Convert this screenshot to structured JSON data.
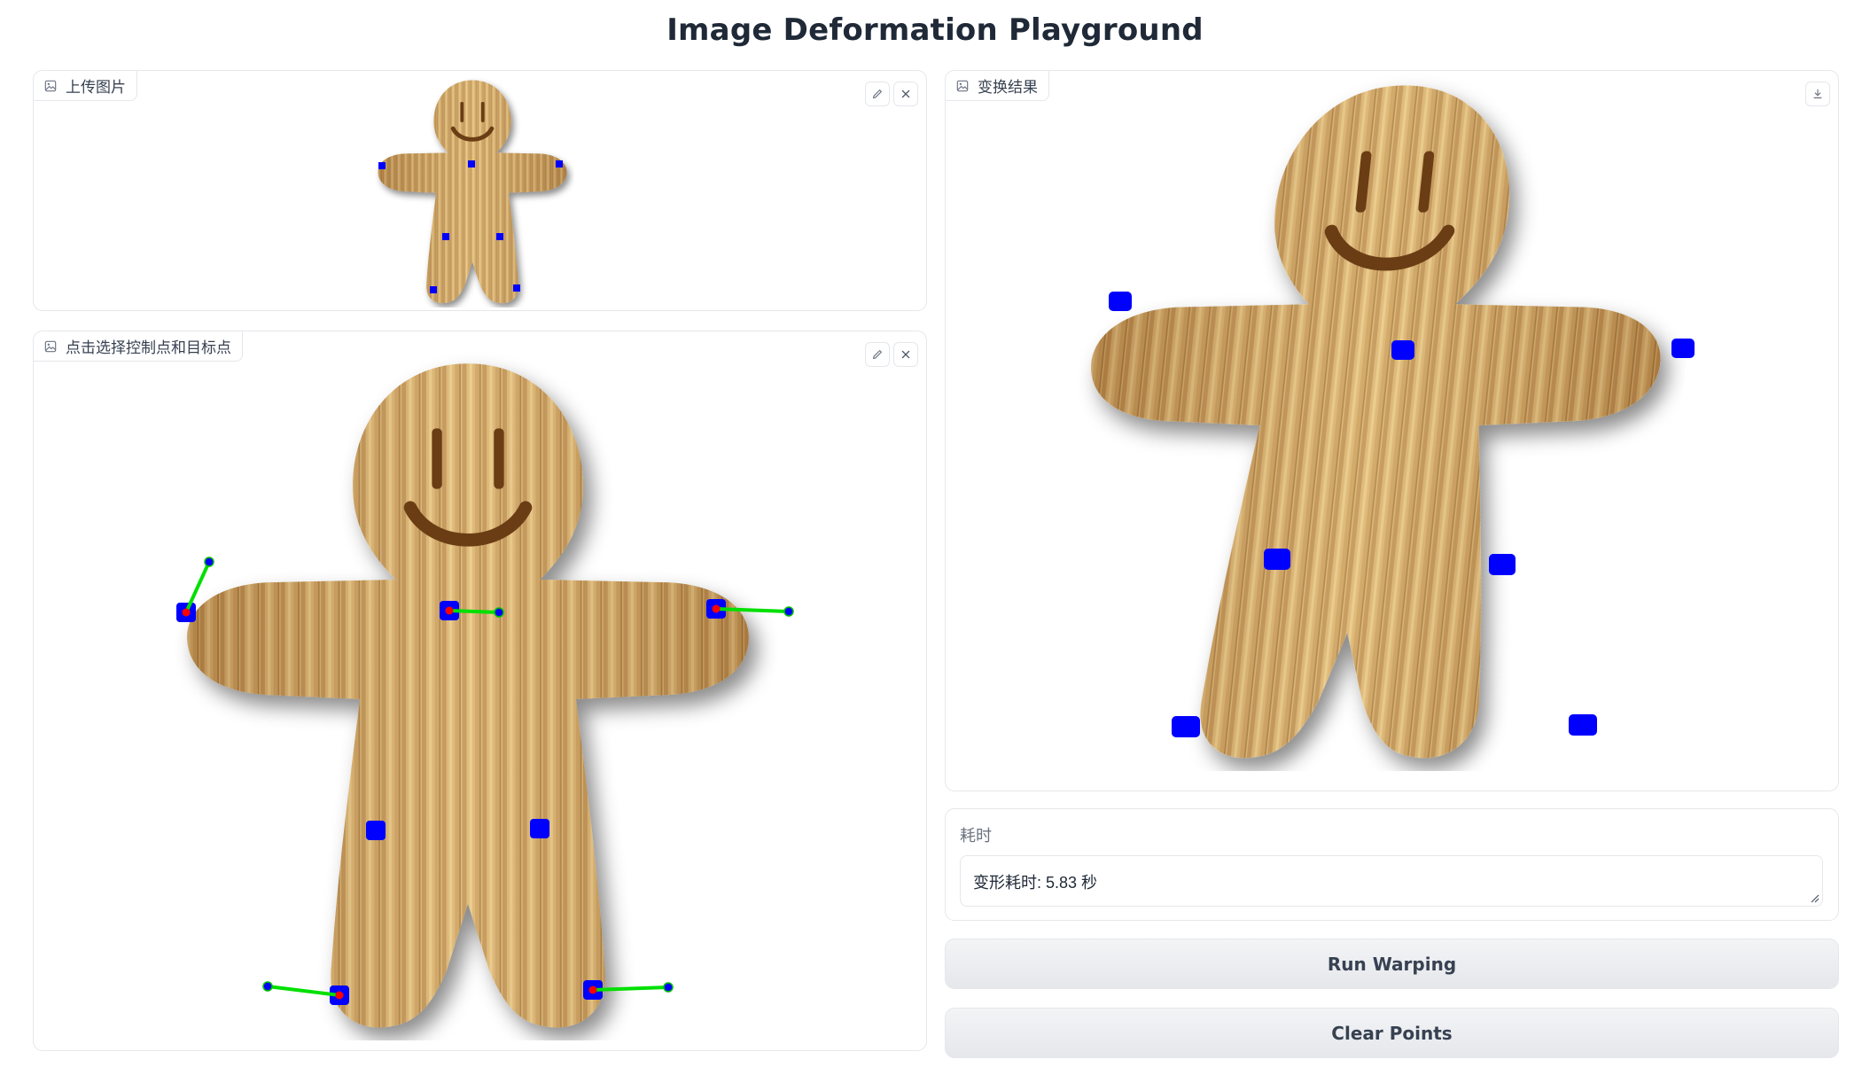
{
  "app": {
    "title": "Image Deformation Playground"
  },
  "upload_panel": {
    "label": "上传图片"
  },
  "select_panel": {
    "label": "点击选择控制点和目标点"
  },
  "result_panel": {
    "label": "变换结果"
  },
  "time_panel": {
    "label": "耗时",
    "value": "变形耗时: 5.83 秒"
  },
  "buttons": {
    "run": "Run Warping",
    "clear": "Clear Points"
  },
  "icons": {
    "image": "image-icon",
    "edit": "pencil-icon",
    "close": "close-icon",
    "download": "download-icon"
  },
  "colors": {
    "control_point": "#0000ff",
    "target_point": "#ff0000",
    "arrow": "#00e000",
    "wood_light": "#e8c98a",
    "wood_dark": "#a9783f"
  }
}
